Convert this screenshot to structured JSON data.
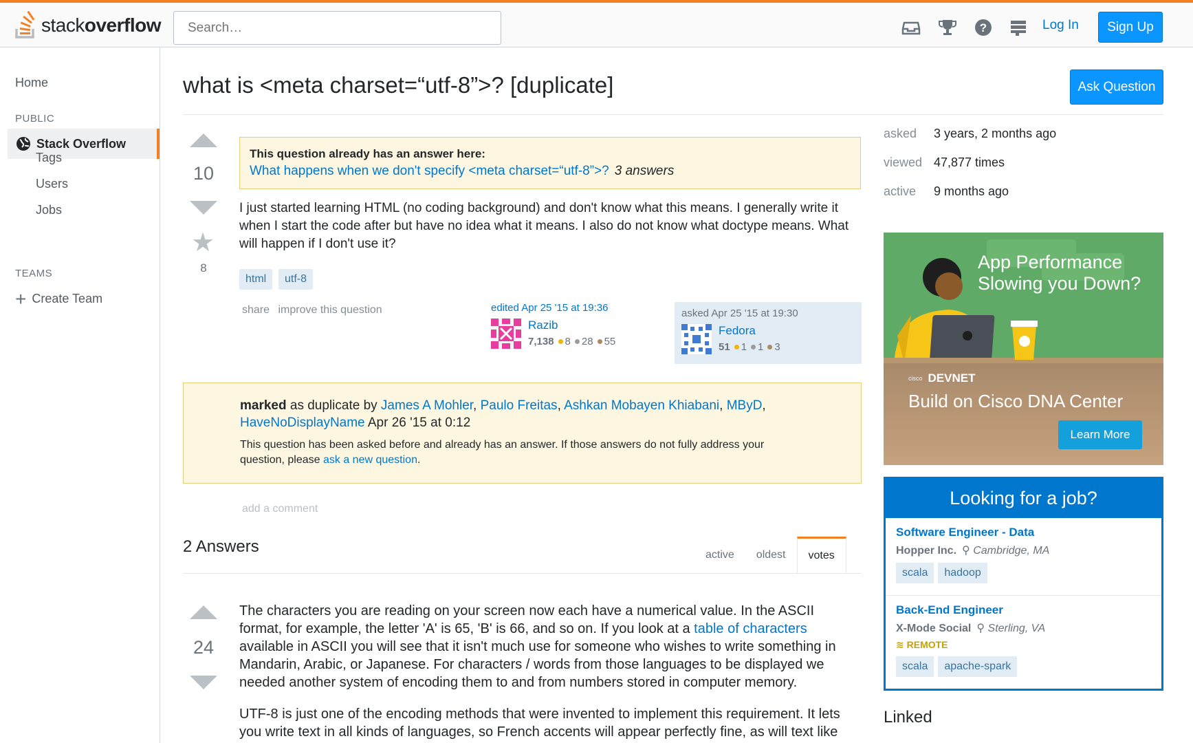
{
  "header": {
    "logo_plain": "stack",
    "logo_bold": "overflow",
    "search_placeholder": "Search…",
    "icons": [
      "inbox-icon",
      "trophy-icon",
      "help-icon",
      "site-switcher-icon"
    ],
    "login_label": "Log In",
    "signup_label": "Sign Up"
  },
  "sidebar": {
    "home": "Home",
    "public_label": "PUBLIC",
    "active_item": "Stack Overflow",
    "items": [
      "Tags",
      "Users",
      "Jobs"
    ],
    "teams_label": "TEAMS",
    "create_team": "Create Team"
  },
  "question": {
    "title": "what is <meta charset=“utf-8”>? [duplicate]",
    "ask_button": "Ask Question",
    "votes": "10",
    "favorites": "8",
    "duplicate_notice": {
      "heading": "This question already has an answer here:",
      "link": "What happens when we don't specify <meta charset=“utf-8”>?",
      "answers": "3 answers"
    },
    "body": "I just started learning HTML (no coding background) and don't know what this means. I generally write it when I start the code after but have no idea what it means. I also do not know what doctype means. What will happen if I don't use it?",
    "tags": [
      "html",
      "utf-8"
    ],
    "menu": {
      "share": "share",
      "improve": "improve this question"
    },
    "edited": {
      "time": "edited Apr 25 '15 at 19:36",
      "user": "Razib",
      "rep": "7,138",
      "gold": "8",
      "silver": "28",
      "bronze": "55"
    },
    "asked": {
      "time": "asked Apr 25 '15 at 19:30",
      "user": "Fedora",
      "rep": "51",
      "gold": "1",
      "silver": "1",
      "bronze": "3"
    },
    "marked": {
      "marked_word": "marked",
      "as_dup": " as duplicate by ",
      "users": [
        "James A Mohler",
        "Paulo Freitas",
        "Ashkan Mobayen Khiabani",
        "MByD",
        "HaveNoDisplayName"
      ],
      "date": " Apr 26 '15 at 0:12",
      "note_before": "This question has been asked before and already has an answer. If those answers do not fully address your question, please ",
      "note_link": "ask a new question",
      "note_after": "."
    },
    "add_comment": "add a comment"
  },
  "answers": {
    "heading": "2 Answers",
    "sort_tabs": [
      "active",
      "oldest",
      "votes"
    ],
    "active_sort": "votes",
    "first": {
      "votes": "24",
      "p1_before": "The characters you are reading on your screen now each have a numerical value. In the ASCII format, for example, the letter 'A' is 65, 'B' is 66, and so on. If you look at a ",
      "p1_link": "table of characters",
      "p1_after": " available in ASCII you will see that it isn't much use for someone who wishes to write something in Mandarin, Arabic, or Japanese. For characters / words from those languages to be displayed we needed another system of encoding them to and from numbers stored in computer memory.",
      "p2": "UTF-8 is just one of the encoding methods that were invented to implement this requirement. It lets you write text in all kinds of languages, so French accents will appear perfectly fine, as will text like"
    }
  },
  "stats": [
    {
      "label": "asked",
      "value": "3 years, 2 months ago"
    },
    {
      "label": "viewed",
      "value": "47,877 times"
    },
    {
      "label": "active",
      "value": "9 months ago"
    }
  ],
  "ad": {
    "title": "App Performance Slowing you Down?",
    "brand_small": "cisco",
    "brand": "DEVNET",
    "headline": "Build on Cisco DNA Center",
    "cta": "Learn More"
  },
  "jobs": {
    "heading": "Looking for a job?",
    "list": [
      {
        "title": "Software Engineer - Data",
        "company": "Hopper Inc.",
        "location": "Cambridge, MA",
        "remote": "",
        "tags": [
          "scala",
          "hadoop"
        ]
      },
      {
        "title": "Back-End Engineer",
        "company": "X-Mode Social",
        "location": "Sterling, VA",
        "remote": "REMOTE",
        "tags": [
          "scala",
          "apache-spark"
        ]
      }
    ]
  },
  "linked_heading": "Linked",
  "colors": {
    "accent_orange": "#f48024",
    "link_blue": "#0077cc",
    "button_blue": "#0a95ff",
    "notice_bg": "#fdf7e2",
    "tag_bg": "#e1ecf4"
  }
}
